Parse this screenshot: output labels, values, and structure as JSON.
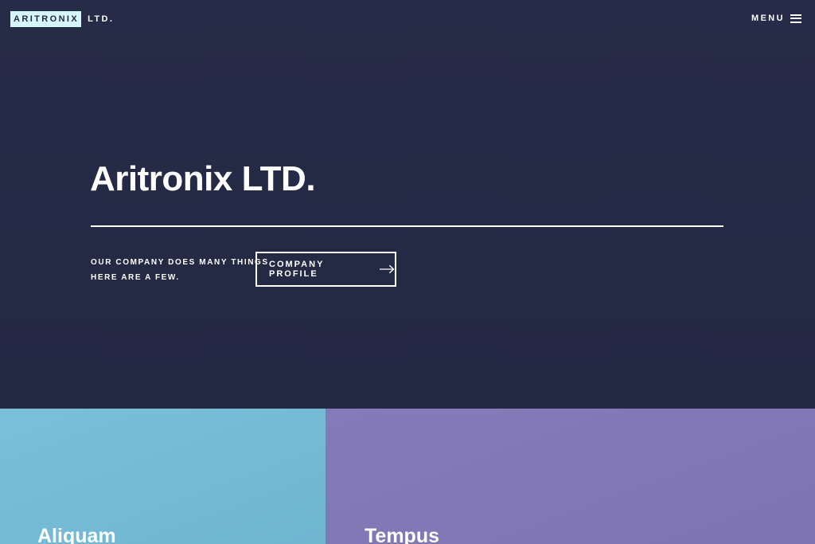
{
  "header": {
    "logo_box": "ARITRONIX",
    "logo_suffix": "LTD.",
    "menu_label": "MENU"
  },
  "banner": {
    "title": "Aritronix LTD.",
    "text_line1": "OUR COMPANY DOES MANY THINGS",
    "text_line2": "HERE ARE A FEW.",
    "button_label": "COMPANY PROFILE"
  },
  "tiles": [
    {
      "title": "Aliquam",
      "color": "#73b8d4"
    },
    {
      "title": "Tempus",
      "color": "#8279b5"
    }
  ],
  "colors": {
    "background": "#242943",
    "logo_box": "#d5f6fa",
    "text": "#ffffff"
  },
  "icons": {
    "menu": "hamburger-icon",
    "button": "arrow-right-icon"
  }
}
